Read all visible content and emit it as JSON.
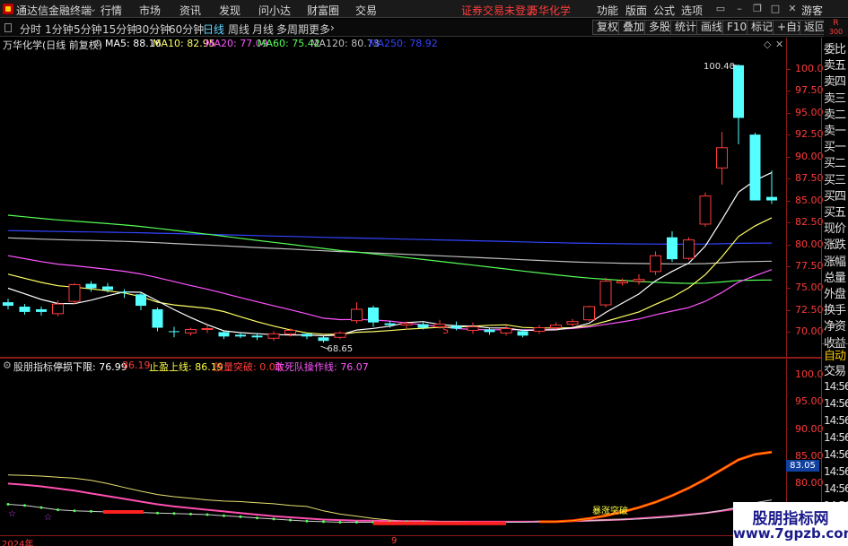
{
  "app": {
    "title": "通达信金融终端",
    "menus": [
      "行情",
      "市场",
      "资讯",
      "发现",
      "问小达",
      "财富圈",
      "交易"
    ],
    "notice": "证券交易未登录",
    "stock_name": "万华化学",
    "right_menus": [
      "功能",
      "版面",
      "公式",
      "选项"
    ],
    "guest": "游客"
  },
  "periods": {
    "items": [
      "分时",
      "1分钟",
      "5分钟",
      "15分钟",
      "30分钟",
      "60分钟",
      "日线",
      "周线",
      "月线",
      "多周期",
      "更多"
    ],
    "active": "日线"
  },
  "toolbar": [
    "复权",
    "叠加",
    "多股",
    "统计",
    "画线",
    "F10",
    "标记",
    "+自选",
    "返回"
  ],
  "ratio": {
    "top": "R",
    "bottom": "300"
  },
  "ma_line": {
    "stock": "万华化学(日线 前复权)",
    "items": [
      {
        "label": "MA5: 88.16",
        "color": "#ffffff"
      },
      {
        "label": "MA10: 82.95",
        "color": "#ffff66"
      },
      {
        "label": "MA20: 77.09",
        "color": "#ff55ff"
      },
      {
        "label": "MA60: 75.42",
        "color": "#55ff55"
      },
      {
        "label": "MA120: 80.73",
        "color": "#c0c0c0"
      },
      {
        "label": "MA250: 78.92",
        "color": "#3344ff"
      }
    ]
  },
  "price_axis": [
    "100.0",
    "97.50",
    "95.00",
    "92.50",
    "90.00",
    "87.50",
    "85.00",
    "82.50",
    "80.00",
    "77.50",
    "75.00",
    "72.50",
    "70.00"
  ],
  "annotations": {
    "high": "100.40",
    "low": "68.65",
    "marker": "S"
  },
  "right_panel": [
    "委比",
    "卖五",
    "卖四",
    "卖三",
    "卖二",
    "卖一",
    "买一",
    "买二",
    "买三",
    "买四",
    "买五",
    "现价",
    "涨跌",
    "涨幅",
    "总量",
    "外盘",
    "换手",
    "净资",
    "收益"
  ],
  "right_panel_bottom": [
    "自动",
    "交易"
  ],
  "right_panel_times": [
    "14:56",
    "14:56",
    "14:56",
    "14:56",
    "14:56",
    "14:56",
    "14:56",
    "14:56",
    "14:56"
  ],
  "sub_header": {
    "name": "股朋指标",
    "items": [
      {
        "label": "停损下限: 76.99",
        "color": "#ffffff"
      },
      {
        "label": "86.19",
        "color": "#ff3b3b"
      },
      {
        "label": "止盈上线: 86.19",
        "color": "#ffff44"
      },
      {
        "label": "放量突破: 0.00",
        "color": "#ff3b3b"
      },
      {
        "label": "敢死队操作线: 76.07",
        "color": "#ff55ff"
      }
    ]
  },
  "sub_axis": [
    "100.0",
    "95.00",
    "90.00",
    "85.00",
    "80.00",
    "75.00"
  ],
  "sub_value_badge": "83.05",
  "sub_annotation": "暴涨突破",
  "dates": [
    "2024年",
    "9",
    "1"
  ],
  "watermark": {
    "line1": "股朋指标网",
    "line2": "www.7gpzb.com"
  },
  "colors": {
    "up": "#ff3b3b",
    "down": "#54ffff",
    "axis": "#8b1a1a"
  },
  "chart_data": {
    "type": "candlestick",
    "title": "万华化学(日线 前复权)",
    "ylim": [
      68,
      101.5
    ],
    "candles": [
      {
        "o": 73.4,
        "c": 73.0,
        "h": 73.8,
        "l": 72.6
      },
      {
        "o": 72.9,
        "c": 72.3,
        "h": 73.2,
        "l": 72.0
      },
      {
        "o": 72.6,
        "c": 72.3,
        "h": 72.9,
        "l": 71.9
      },
      {
        "o": 72.1,
        "c": 73.2,
        "h": 73.6,
        "l": 71.8
      },
      {
        "o": 73.5,
        "c": 75.4,
        "h": 75.6,
        "l": 73.2
      },
      {
        "o": 75.5,
        "c": 75.0,
        "h": 75.8,
        "l": 74.6
      },
      {
        "o": 75.2,
        "c": 74.8,
        "h": 75.6,
        "l": 74.5
      },
      {
        "o": 74.6,
        "c": 74.5,
        "h": 74.9,
        "l": 73.9
      },
      {
        "o": 74.3,
        "c": 73.0,
        "h": 74.5,
        "l": 72.5
      },
      {
        "o": 72.6,
        "c": 70.5,
        "h": 72.8,
        "l": 70.1
      },
      {
        "o": 70.1,
        "c": 70.0,
        "h": 70.6,
        "l": 69.4
      },
      {
        "o": 69.9,
        "c": 70.3,
        "h": 70.5,
        "l": 69.6
      },
      {
        "o": 70.3,
        "c": 70.4,
        "h": 70.8,
        "l": 69.9
      },
      {
        "o": 70.0,
        "c": 69.5,
        "h": 70.1,
        "l": 69.2
      },
      {
        "o": 69.7,
        "c": 69.5,
        "h": 69.9,
        "l": 69.3
      },
      {
        "o": 69.6,
        "c": 69.4,
        "h": 69.9,
        "l": 69.1
      },
      {
        "o": 69.3,
        "c": 69.8,
        "h": 70.1,
        "l": 69.0
      },
      {
        "o": 69.8,
        "c": 70.2,
        "h": 70.4,
        "l": 69.5
      },
      {
        "o": 69.8,
        "c": 69.5,
        "h": 69.9,
        "l": 69.2
      },
      {
        "o": 69.4,
        "c": 69.0,
        "h": 69.6,
        "l": 68.8
      },
      {
        "o": 69.4,
        "c": 69.9,
        "h": 70.1,
        "l": 69.2
      },
      {
        "o": 71.3,
        "c": 72.6,
        "h": 73.4,
        "l": 71.0
      },
      {
        "o": 72.8,
        "c": 71.1,
        "h": 73.0,
        "l": 70.6
      },
      {
        "o": 71.0,
        "c": 70.8,
        "h": 71.3,
        "l": 70.5
      },
      {
        "o": 70.8,
        "c": 71.0,
        "h": 71.2,
        "l": 70.3
      },
      {
        "o": 70.9,
        "c": 70.5,
        "h": 71.1,
        "l": 70.3
      },
      {
        "o": 70.6,
        "c": 70.9,
        "h": 71.4,
        "l": 70.4
      },
      {
        "o": 70.7,
        "c": 70.4,
        "h": 71.2,
        "l": 70.2
      },
      {
        "o": 70.2,
        "c": 70.6,
        "h": 71.1,
        "l": 69.8
      },
      {
        "o": 70.3,
        "c": 70.0,
        "h": 70.5,
        "l": 69.7
      },
      {
        "o": 69.9,
        "c": 70.4,
        "h": 70.8,
        "l": 69.6
      },
      {
        "o": 70.1,
        "c": 69.6,
        "h": 70.3,
        "l": 69.4
      },
      {
        "o": 70.1,
        "c": 70.5,
        "h": 70.8,
        "l": 69.8
      },
      {
        "o": 70.5,
        "c": 70.8,
        "h": 71.1,
        "l": 70.3
      },
      {
        "o": 70.9,
        "c": 71.2,
        "h": 71.5,
        "l": 70.6
      },
      {
        "o": 71.4,
        "c": 72.9,
        "h": 73.0,
        "l": 71.2
      },
      {
        "o": 73.1,
        "c": 75.8,
        "h": 76.2,
        "l": 72.8
      },
      {
        "o": 75.6,
        "c": 75.8,
        "h": 76.1,
        "l": 75.3
      },
      {
        "o": 75.8,
        "c": 76.0,
        "h": 76.6,
        "l": 75.4
      },
      {
        "o": 76.9,
        "c": 78.7,
        "h": 79.2,
        "l": 76.5
      },
      {
        "o": 80.8,
        "c": 78.3,
        "h": 81.5,
        "l": 78.0
      },
      {
        "o": 78.4,
        "c": 80.5,
        "h": 80.8,
        "l": 78.2
      },
      {
        "o": 82.3,
        "c": 85.5,
        "h": 85.9,
        "l": 82.0
      },
      {
        "o": 88.7,
        "c": 91.0,
        "h": 92.8,
        "l": 86.8
      },
      {
        "o": 100.4,
        "c": 94.4,
        "h": 100.5,
        "l": 91.4
      },
      {
        "o": 92.5,
        "c": 85.0,
        "h": 92.7,
        "l": 85.0
      },
      {
        "o": 85.4,
        "c": 85.0,
        "h": 88.4,
        "l": 84.6
      }
    ],
    "series": [
      {
        "name": "MA5",
        "color": "#ffffff"
      },
      {
        "name": "MA10",
        "color": "#ffff66"
      },
      {
        "name": "MA20",
        "color": "#ff55ff"
      },
      {
        "name": "MA60",
        "color": "#55ff55"
      },
      {
        "name": "MA120",
        "color": "#c0c0c0"
      },
      {
        "name": "MA250",
        "color": "#3344ff"
      }
    ]
  }
}
